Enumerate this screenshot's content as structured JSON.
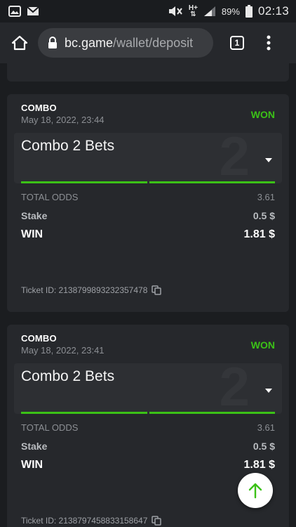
{
  "status_bar": {
    "battery_percent": "89%",
    "time": "02:13",
    "network_label": "H+"
  },
  "browser": {
    "url_host": "bc.game",
    "url_path": "/wallet/deposit",
    "tab_count": "1"
  },
  "bets": [
    {
      "type": "COMBO",
      "date": "May 18, 2022, 23:44",
      "status": "WON",
      "combo_title": "Combo 2 Bets",
      "combo_watermark": "2",
      "total_odds_label": "TOTAL ODDS",
      "total_odds_value": "3.61",
      "stake_label": "Stake",
      "stake_value": "0.5 $",
      "win_label": "WIN",
      "win_value": "1.81 $",
      "ticket_id": "Ticket ID: 2138799893232357478"
    },
    {
      "type": "COMBO",
      "date": "May 18, 2022, 23:41",
      "status": "WON",
      "combo_title": "Combo 2 Bets",
      "combo_watermark": "2",
      "total_odds_label": "TOTAL ODDS",
      "total_odds_value": "3.61",
      "stake_label": "Stake",
      "stake_value": "0.5 $",
      "win_label": "WIN",
      "win_value": "1.81 $",
      "ticket_id": "Ticket ID: 2138797458833158647"
    }
  ],
  "colors": {
    "won_green": "#3bc117",
    "card_bg": "#26282c",
    "page_bg": "#1b1d20"
  },
  "icons": {
    "home": "home-icon",
    "lock": "lock-icon",
    "menu": "more-vert-icon",
    "copy": "copy-icon",
    "scroll_top": "arrow-up-icon"
  }
}
